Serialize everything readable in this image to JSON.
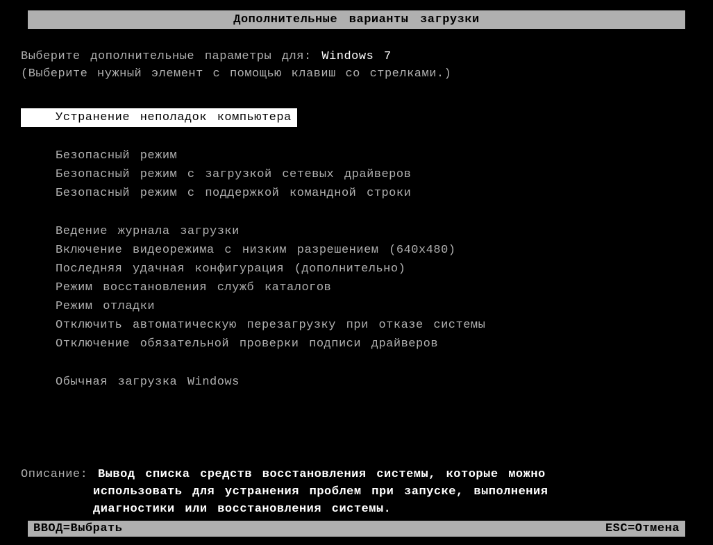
{
  "header": {
    "title": "Дополнительные варианты загрузки"
  },
  "prompt": {
    "label": "Выберите дополнительные параметры для:",
    "os_name": "Windows 7"
  },
  "instruction": "(Выберите нужный элемент с помощью клавиш со стрелками.)",
  "menu": {
    "groups": [
      {
        "items": [
          {
            "label": "Устранение неполадок компьютера",
            "selected": true
          }
        ]
      },
      {
        "items": [
          {
            "label": "Безопасный режим",
            "selected": false
          },
          {
            "label": "Безопасный режим с загрузкой сетевых драйверов",
            "selected": false
          },
          {
            "label": "Безопасный режим с поддержкой командной строки",
            "selected": false
          }
        ]
      },
      {
        "items": [
          {
            "label": "Ведение журнала загрузки",
            "selected": false
          },
          {
            "label": "Включение видеорежима с низким разрешением (640x480)",
            "selected": false
          },
          {
            "label": "Последняя удачная конфигурация (дополнительно)",
            "selected": false
          },
          {
            "label": "Режим восстановления служб каталогов",
            "selected": false
          },
          {
            "label": "Режим отладки",
            "selected": false
          },
          {
            "label": "Отключить автоматическую перезагрузку при отказе системы",
            "selected": false
          },
          {
            "label": "Отключение обязательной проверки подписи драйверов",
            "selected": false
          }
        ]
      },
      {
        "items": [
          {
            "label": "Обычная загрузка Windows",
            "selected": false
          }
        ]
      }
    ]
  },
  "description": {
    "label": "Описание:",
    "line1": "Вывод списка средств восстановления системы, которые можно",
    "line2": "использовать для устранения проблем при запуске, выполнения",
    "line3": "диагностики или восстановления системы."
  },
  "footer": {
    "enter": "ВВОД=Выбрать",
    "esc": "ESC=Отмена"
  }
}
